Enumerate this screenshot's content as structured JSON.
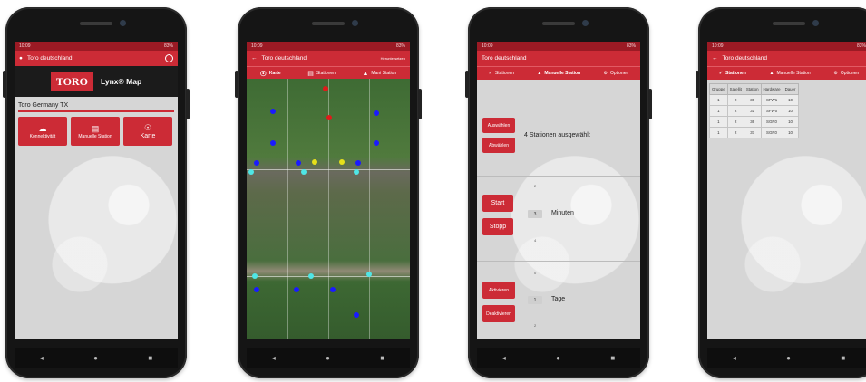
{
  "colors": {
    "brand_red": "#cc2b36",
    "status_red": "#9b1a24"
  },
  "status": {
    "time": "10:09",
    "battery": "83%"
  },
  "phone1": {
    "title": "Toro deutschland",
    "logo_brand": "TORO",
    "logo_product": "Lynx® Map",
    "project": "Toro Germany TX",
    "buttons": [
      {
        "label": "Konnektivität",
        "icon": "cloud-icon"
      },
      {
        "label": "Manuelle Station",
        "icon": "document-icon"
      },
      {
        "label": "Karte",
        "icon": "globe-icon"
      }
    ]
  },
  "phone2": {
    "title": "Toro deutschland",
    "right_text": "Heruntersetzen",
    "tabs": [
      {
        "label": "Karte",
        "icon": "globe-icon"
      },
      {
        "label": "Stationen",
        "icon": "list-icon"
      },
      {
        "label": "Mani Station",
        "icon": "person-icon"
      }
    ]
  },
  "phone3": {
    "title": "Toro deutschland",
    "tabs": [
      {
        "label": "Stationen",
        "icon": "check-icon"
      },
      {
        "label": "Manuelle Station",
        "icon": "person-icon"
      },
      {
        "label": "Optionen",
        "icon": "gear-icon"
      }
    ],
    "select_label": "Auswählen",
    "deselect_label": "Abwählen",
    "selected_text": "4 Stationen ausgewählt",
    "start_label": "Start",
    "stop_label": "Stopp",
    "minutes_label": "Minuten",
    "minutes_value": "3",
    "minutes_prev": "2",
    "minutes_next": "4",
    "days_label": "Tage",
    "days_value": "1",
    "days_prev": "0",
    "days_next": "2",
    "activate_label": "Aktivieren",
    "deactivate_label": "Deaktivieren"
  },
  "phone4": {
    "title": "Toro deutschland",
    "tabs": [
      {
        "label": "Stationen",
        "icon": "check-icon"
      },
      {
        "label": "Manuelle Station",
        "icon": "person-icon"
      },
      {
        "label": "Optionen",
        "icon": "gear-icon"
      }
    ],
    "columns": [
      "Gruppe",
      "Satellit",
      "Station",
      "Hardware",
      "Dauer"
    ],
    "rows": [
      [
        "1",
        "2",
        "30",
        "SFW1",
        "10"
      ],
      [
        "1",
        "2",
        "31",
        "SFW0",
        "10"
      ],
      [
        "1",
        "2",
        "36",
        "SGR0",
        "10"
      ],
      [
        "1",
        "2",
        "37",
        "SGR0",
        "10"
      ]
    ]
  },
  "nav": {
    "back": "◂",
    "home": "●",
    "recents": "■"
  }
}
